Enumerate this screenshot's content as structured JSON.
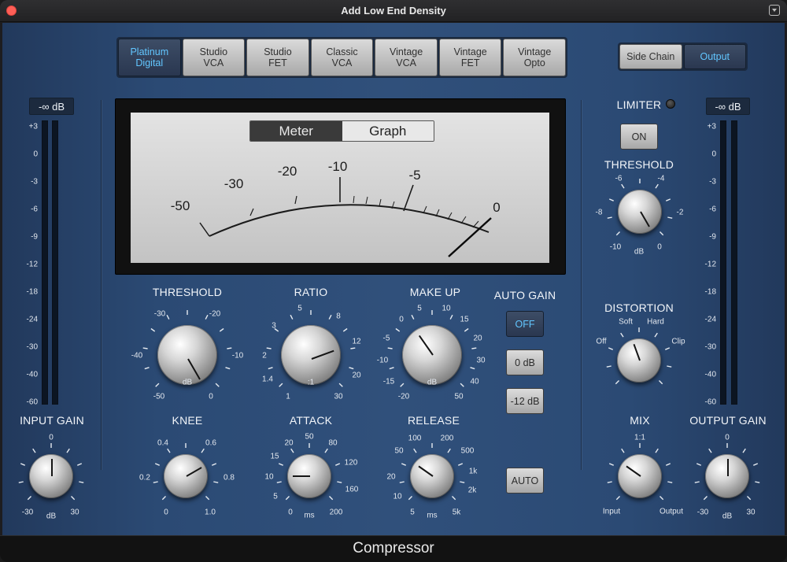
{
  "window": {
    "title": "Add Low End Density",
    "footer_label": "Compressor"
  },
  "models": [
    {
      "label": "Platinum\nDigital",
      "active": true
    },
    {
      "label": "Studio\nVCA",
      "active": false
    },
    {
      "label": "Studio\nFET",
      "active": false
    },
    {
      "label": "Classic\nVCA",
      "active": false
    },
    {
      "label": "Vintage\nVCA",
      "active": false
    },
    {
      "label": "Vintage\nFET",
      "active": false
    },
    {
      "label": "Vintage\nOpto",
      "active": false
    }
  ],
  "sidechain_toggle": {
    "side_chain": "Side Chain",
    "output": "Output",
    "selected": "Output"
  },
  "meter": {
    "toggle_meter": "Meter",
    "toggle_graph": "Graph",
    "selected": "Meter",
    "scale_labels": [
      "-50",
      "-30",
      "-20",
      "-10",
      "-5",
      "0"
    ]
  },
  "input": {
    "readout": "-∞ dB",
    "scale": [
      "+3",
      "0",
      "-3",
      "-6",
      "-9",
      "-12",
      "-18",
      "-24",
      "-30",
      "-40",
      "-60"
    ]
  },
  "output": {
    "readout": "-∞ dB",
    "scale": [
      "+3",
      "0",
      "-3",
      "-6",
      "-9",
      "-12",
      "-18",
      "-24",
      "-30",
      "-40",
      "-60"
    ]
  },
  "knobs": {
    "threshold": {
      "title": "THRESHOLD",
      "unit": "dB",
      "labels": [
        "-50",
        "-40",
        "-30",
        "-20",
        "-10",
        "0"
      ]
    },
    "ratio": {
      "title": "RATIO",
      "unit": ":1",
      "labels": [
        "1",
        "1.4",
        "2",
        "3",
        "5",
        "8",
        "12",
        "20",
        "30"
      ]
    },
    "makeup": {
      "title": "MAKE UP",
      "unit": "dB",
      "labels": [
        "-20",
        "-15",
        "-10",
        "-5",
        "0",
        "5",
        "10",
        "15",
        "20",
        "30",
        "40",
        "50"
      ]
    },
    "knee": {
      "title": "KNEE",
      "labels": [
        "0",
        "0.2",
        "0.4",
        "0.6",
        "0.8",
        "1.0"
      ]
    },
    "attack": {
      "title": "ATTACK",
      "unit": "ms",
      "labels": [
        "0",
        "5",
        "10",
        "15",
        "20",
        "50",
        "80",
        "120",
        "160",
        "200"
      ]
    },
    "release": {
      "title": "RELEASE",
      "unit": "ms",
      "labels": [
        "5",
        "10",
        "20",
        "50",
        "100",
        "200",
        "500",
        "1k",
        "2k",
        "5k"
      ]
    },
    "input_gain": {
      "title": "INPUT GAIN",
      "unit": "dB",
      "labels": [
        "-30",
        "0",
        "30"
      ]
    },
    "output_gain": {
      "title": "OUTPUT GAIN",
      "unit": "dB",
      "labels": [
        "-30",
        "0",
        "30"
      ]
    },
    "limiter_threshold": {
      "title": "THRESHOLD",
      "unit": "dB",
      "labels": [
        "-10",
        "-8",
        "-6",
        "-4",
        "-2",
        "0"
      ]
    },
    "distortion": {
      "title": "DISTORTION",
      "labels": [
        "Off",
        "Soft",
        "Hard",
        "Clip"
      ]
    },
    "mix": {
      "title": "MIX",
      "labels": [
        "Input",
        "1:1",
        "Output"
      ]
    }
  },
  "auto_gain": {
    "title": "AUTO GAIN",
    "options": [
      "OFF",
      "0 dB",
      "-12 dB"
    ],
    "selected": "OFF"
  },
  "auto_release": {
    "label": "AUTO"
  },
  "limiter": {
    "title": "LIMITER",
    "button": "ON"
  }
}
